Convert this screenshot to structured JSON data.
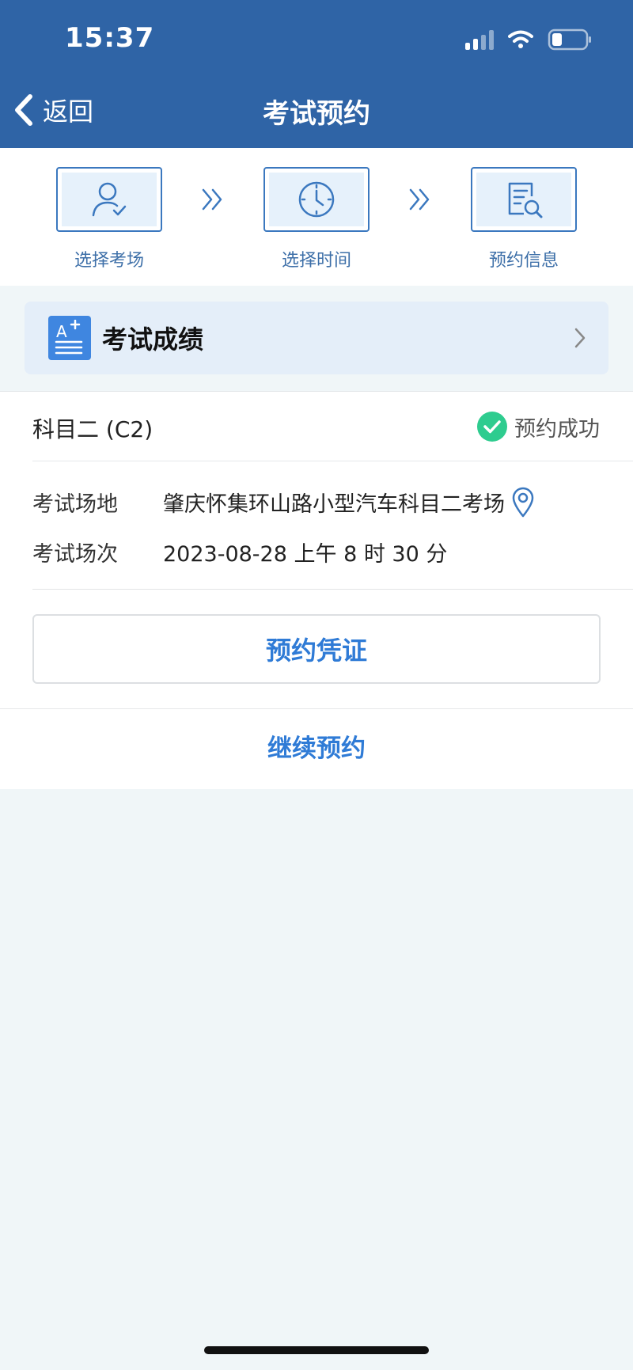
{
  "status_bar": {
    "time": "15:37"
  },
  "header": {
    "back_label": "返回",
    "title": "考试预约"
  },
  "steps": [
    {
      "label": "选择考场",
      "icon": "person-check-icon"
    },
    {
      "label": "选择时间",
      "icon": "clock-icon"
    },
    {
      "label": "预约信息",
      "icon": "document-search-icon"
    }
  ],
  "score_card": {
    "label": "考试成绩",
    "icon": "grade-a-plus-icon"
  },
  "appointment": {
    "subject": "科目二 (C2)",
    "status": "预约成功",
    "venue_label": "考试场地",
    "venue_value": "肇庆怀集环山路小型汽车科目二考场",
    "session_label": "考试场次",
    "session_value": "2023-08-28 上午 8 时 30 分"
  },
  "actions": {
    "voucher_label": "预约凭证",
    "continue_label": "继续预约"
  },
  "colors": {
    "header_bg": "#2f64a6",
    "accent_blue": "#2f7bd6",
    "success_green": "#2ecc8f",
    "page_bg": "#f0f6f8"
  }
}
